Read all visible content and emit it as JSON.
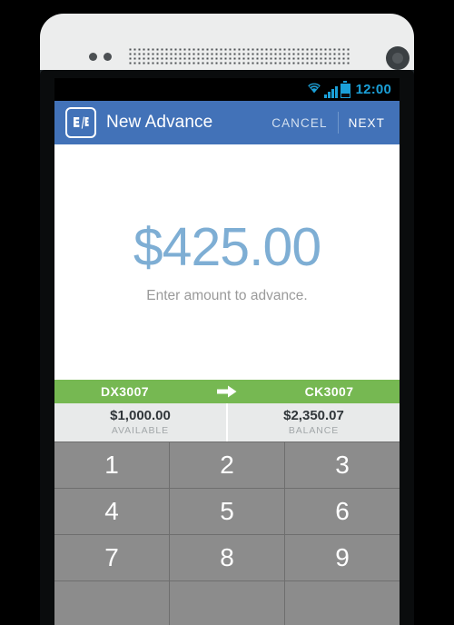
{
  "status_bar": {
    "time": "12:00",
    "wifi_icon": "wifi-icon",
    "signal_icon": "signal-bars-icon",
    "battery_icon": "battery-icon",
    "accent_color": "#1ba0d8"
  },
  "app_bar": {
    "logo_name": "fifth-third-bank-logo",
    "logo_text": "5/3",
    "title": "New Advance",
    "cancel_label": "CANCEL",
    "next_label": "NEXT",
    "background_color": "#4272b8"
  },
  "amount_area": {
    "amount": "$425.00",
    "hint": "Enter amount to advance.",
    "amount_color": "#7eaed4"
  },
  "accounts": {
    "from": "DX3007",
    "to": "CK3007",
    "arrow_icon": "arrow-right-icon",
    "bar_color": "#76b852"
  },
  "balances": [
    {
      "value": "$1,000.00",
      "label": "AVAILABLE"
    },
    {
      "value": "$2,350.07",
      "label": "BALANCE"
    }
  ],
  "keypad": {
    "keys": [
      "1",
      "2",
      "3",
      "4",
      "5",
      "6",
      "7",
      "8",
      "9"
    ],
    "key_color": "#8c8c8c"
  }
}
